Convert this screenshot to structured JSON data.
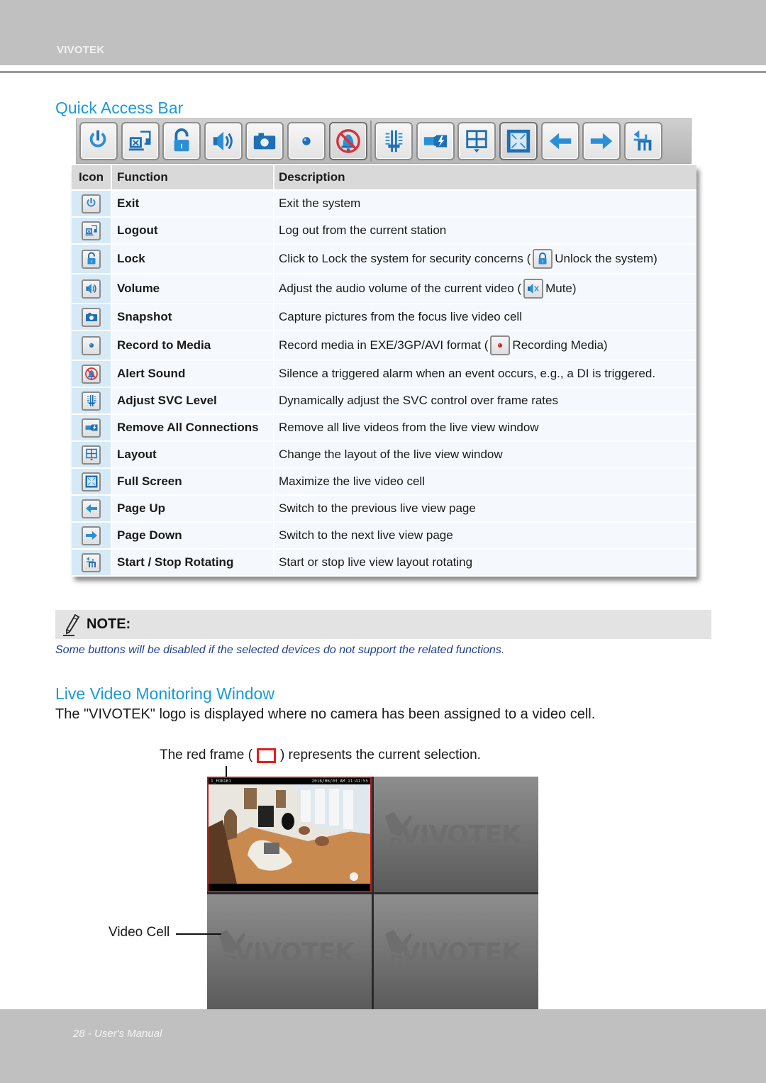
{
  "header": {
    "brand": "VIVOTEK"
  },
  "quick_access": {
    "title": "Quick Access Bar",
    "toolbar_buttons": [
      {
        "icon": "power-icon",
        "label": "Exit"
      },
      {
        "icon": "logout-icon",
        "label": "Logout"
      },
      {
        "icon": "unlock-icon",
        "label": "Lock"
      },
      {
        "icon": "volume-icon",
        "label": "Volume"
      },
      {
        "icon": "camera-icon",
        "label": "Snapshot"
      },
      {
        "icon": "record-dot-icon",
        "label": "Record to Media"
      },
      {
        "icon": "alert-bell-muted-icon",
        "label": "Alert Sound"
      },
      {
        "icon": "svc-level-icon",
        "label": "Adjust SVC Level"
      },
      {
        "icon": "remove-connections-icon",
        "label": "Remove All Connections"
      },
      {
        "icon": "layout-grid-icon",
        "label": "Layout"
      },
      {
        "icon": "fullscreen-icon",
        "label": "Full Screen"
      },
      {
        "icon": "arrow-left-icon",
        "label": "Page Up"
      },
      {
        "icon": "arrow-right-icon",
        "label": "Page Down"
      },
      {
        "icon": "rotate-icon",
        "label": "Start / Stop Rotating"
      }
    ],
    "table": {
      "headers": {
        "icon": "Icon",
        "function": "Function",
        "description": "Description"
      },
      "rows": [
        {
          "icon": "power-icon",
          "function": "Exit",
          "description": "Exit the system"
        },
        {
          "icon": "logout-icon",
          "function": "Logout",
          "description": "Log out from the current station"
        },
        {
          "icon": "unlock-icon",
          "function": "Lock",
          "description": "Click to Lock the system for security concerns (",
          "inline_icon": "lock-icon",
          "description_after": "Unlock the system)"
        },
        {
          "icon": "volume-icon",
          "function": "Volume",
          "description": "Adjust the audio volume of the current video (",
          "inline_icon": "mute-icon",
          "description_after": "Mute)"
        },
        {
          "icon": "camera-icon",
          "function": "Snapshot",
          "description": "Capture pictures from the focus live video cell"
        },
        {
          "icon": "record-dot-icon",
          "function": "Record to Media",
          "description": "Record media in EXE/3GP/AVI format (",
          "inline_icon": "recording-red-dot-icon",
          "description_after": "Recording Media)"
        },
        {
          "icon": "alert-bell-muted-icon",
          "function": "Alert Sound",
          "description": "Silence a triggered alarm when an event occurs, e.g., a DI is triggered."
        },
        {
          "icon": "svc-level-icon",
          "function": "Adjust SVC Level",
          "description": "Dynamically adjust the SVC control over frame rates"
        },
        {
          "icon": "remove-connections-icon",
          "function": "Remove All Connections",
          "description": "Remove all live videos from the live view window"
        },
        {
          "icon": "layout-grid-icon",
          "function": "Layout",
          "description": "Change the layout of the live view window"
        },
        {
          "icon": "fullscreen-icon",
          "function": "Full Screen",
          "description": "Maximize the live video cell"
        },
        {
          "icon": "arrow-left-icon",
          "function": "Page Up",
          "description": "Switch to the previous live view page"
        },
        {
          "icon": "arrow-right-icon",
          "function": "Page Down",
          "description": "Switch to the next live view page"
        },
        {
          "icon": "rotate-icon",
          "function": "Start / Stop Rotating",
          "description": "Start or stop live view layout rotating"
        }
      ]
    }
  },
  "note": {
    "label": "NOTE:",
    "text": "Some buttons will be disabled if the selected devices do not support the related functions."
  },
  "live_video": {
    "title": "Live Video Monitoring Window",
    "paragraph": "The \"VIVOTEK\" logo is displayed where no camera has been assigned to a video cell.",
    "red_frame_before": "The red frame (",
    "red_frame_after": ") represents the current selection.",
    "video_cell_label": "Video Cell",
    "cells": [
      {
        "state": "live",
        "camera_name": "1_FD8161",
        "timestamp": "2016/06/03 AM 11:41:55",
        "selected": true
      },
      {
        "state": "empty",
        "logo": "VIVOTEK"
      },
      {
        "state": "empty",
        "logo": "VIVOTEK"
      },
      {
        "state": "empty",
        "logo": "VIVOTEK"
      }
    ],
    "colors": {
      "selection": "#e0201c"
    }
  },
  "footer": {
    "text": "28 - User's Manual"
  },
  "colors": {
    "heading": "#1a9ad9",
    "note_text": "#1f3f8f",
    "band": "#bfc0bf"
  }
}
